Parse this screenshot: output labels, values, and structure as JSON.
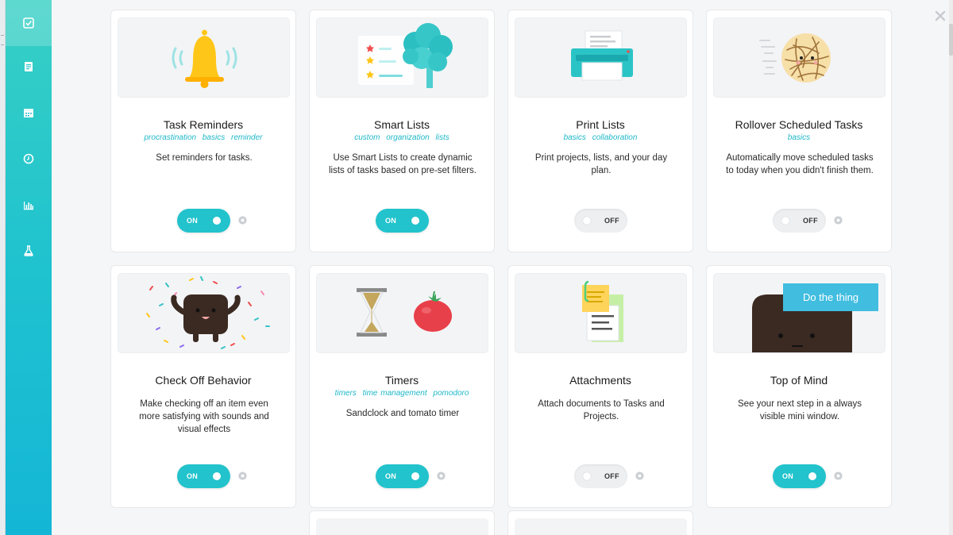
{
  "colors": {
    "accent": "#22c3cc",
    "tag": "#1fb8c8",
    "sidebar_top": "#37d0c4",
    "sidebar_bottom": "#14b6d6"
  },
  "sidebar": {
    "items": [
      {
        "icon": "checkbox-icon",
        "active": true
      },
      {
        "icon": "notes-icon",
        "active": false
      },
      {
        "icon": "calendar-icon",
        "active": false
      },
      {
        "icon": "clock-icon",
        "active": false
      },
      {
        "icon": "bar-chart-icon",
        "active": false
      },
      {
        "icon": "flask-icon",
        "active": false
      }
    ]
  },
  "close_icon": "close-icon",
  "cards": [
    {
      "title": "Task Reminders",
      "tags": [
        "procrastination",
        "basics",
        "reminder"
      ],
      "description": "Set reminders for tasks.",
      "toggle": "ON",
      "has_settings": true,
      "illustration": "bell"
    },
    {
      "title": "Smart Lists",
      "tags": [
        "custom",
        "organization",
        "lists"
      ],
      "description": "Use Smart Lists to create dynamic lists of tasks based on pre-set filters.",
      "toggle": "ON",
      "has_settings": false,
      "illustration": "brain-tree"
    },
    {
      "title": "Print Lists",
      "tags": [
        "basics",
        "collaboration"
      ],
      "description": "Print projects, lists, and your day plan.",
      "toggle": "OFF",
      "has_settings": false,
      "illustration": "printer"
    },
    {
      "title": "Rollover Scheduled Tasks",
      "tags": [
        "basics"
      ],
      "description": "Automatically move scheduled tasks to today when you didn't finish them.",
      "toggle": "OFF",
      "has_settings": true,
      "illustration": "tumbleweed"
    },
    {
      "title": "Check Off Behavior",
      "tags": [],
      "description": "Make checking off an item even more satisfying with sounds and visual effects",
      "toggle": "ON",
      "has_settings": true,
      "illustration": "confetti-character"
    },
    {
      "title": "Timers",
      "tags": [
        "timers",
        "time management",
        "pomodoro"
      ],
      "description": "Sandclock and tomato timer",
      "toggle": "ON",
      "has_settings": true,
      "illustration": "hourglass-tomato"
    },
    {
      "title": "Attachments",
      "tags": [],
      "description": "Attach documents to Tasks and Projects.",
      "toggle": "OFF",
      "has_settings": true,
      "illustration": "documents"
    },
    {
      "title": "Top of Mind",
      "tags": [],
      "description": "See your next step in a always visible mini window.",
      "toggle": "ON",
      "has_settings": true,
      "illustration": "peeking-character",
      "illustration_text": "Do the thing"
    }
  ]
}
